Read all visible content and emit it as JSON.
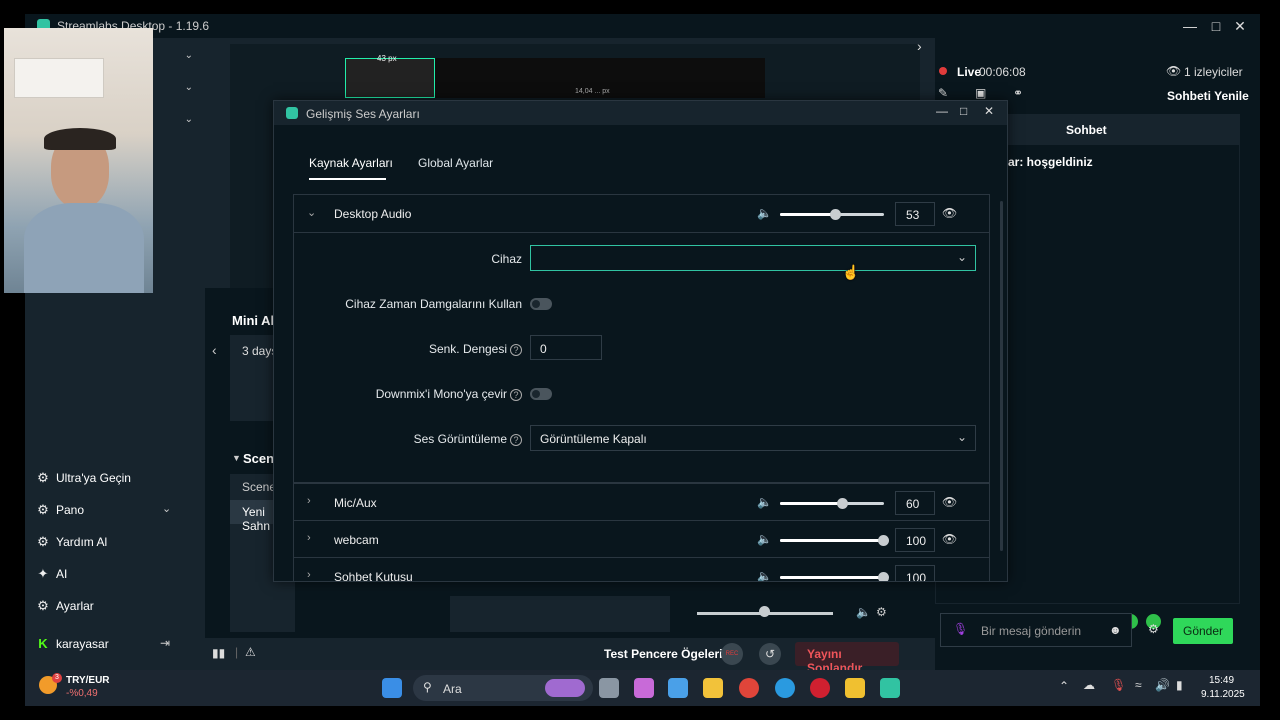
{
  "window": {
    "title": "Streamlabs Desktop - 1.19.6"
  },
  "nav": {
    "items": [
      {
        "label": "Ultra'ya Geçin",
        "icon": "gear-icon"
      },
      {
        "label": "Pano",
        "icon": "gear-icon"
      },
      {
        "label": "Yardım Al",
        "icon": "gear-icon"
      },
      {
        "label": "AI",
        "icon": "sparkle-icon"
      },
      {
        "label": "Ayarlar",
        "icon": "gear-icon"
      }
    ],
    "user": "karayasar"
  },
  "center": {
    "preview_px": "43 px",
    "preview_px2": "14,04 ... px",
    "mini_title": "Mini Akış",
    "mini_item": "3 days",
    "scenes_title": "Scenes",
    "scene_header": "Scene",
    "scene_item": "Yeni Sahn",
    "test_label": "Test Pencere Ögeleri",
    "rec_label": "REC",
    "end_stream": "Yayını Sonlandır"
  },
  "right": {
    "live_label": "Live",
    "timer": "00:06:08",
    "viewers": "1 izleyiciler",
    "refresh_chat": "Sohbeti Yenile",
    "chat_title": "Sohbet",
    "chat_message": "ar: hoşgeldiniz",
    "chat_placeholder": "Bir mesaj gönderin",
    "send_label": "Gönder"
  },
  "dialog": {
    "title": "Gelişmiş Ses Ayarları",
    "tabs": [
      "Kaynak Ayarları",
      "Global Ayarlar"
    ],
    "active_tab": 0,
    "sources": [
      {
        "name": "Desktop Audio",
        "volume": 53,
        "expanded": true
      },
      {
        "name": "Mic/Aux",
        "volume": 60,
        "expanded": false
      },
      {
        "name": "webcam",
        "volume": 100,
        "expanded": false
      },
      {
        "name": "Sohbet Kutusu",
        "volume": 100,
        "expanded": false
      }
    ],
    "settings": {
      "device_label": "Cihaz",
      "device_value": "",
      "timestamps_label": "Cihaz Zaman Damgalarını Kullan",
      "sync_label": "Senk. Dengesi",
      "sync_value": "0",
      "downmix_label": "Downmix'i Mono'ya çevir",
      "monitor_label": "Ses Görüntüleme",
      "monitor_value": "Görüntüleme Kapalı"
    }
  },
  "taskbar": {
    "currency_pair": "TRY/EUR",
    "currency_change": "-%0,49",
    "badge": "3",
    "search_placeholder": "Ara",
    "time": "15:49",
    "date": "9.11.2025"
  },
  "colors": {
    "accent": "#31c3a2",
    "live_red": "#e03b3b",
    "send_green": "#2fd85a",
    "end_red": "#f0555a"
  }
}
